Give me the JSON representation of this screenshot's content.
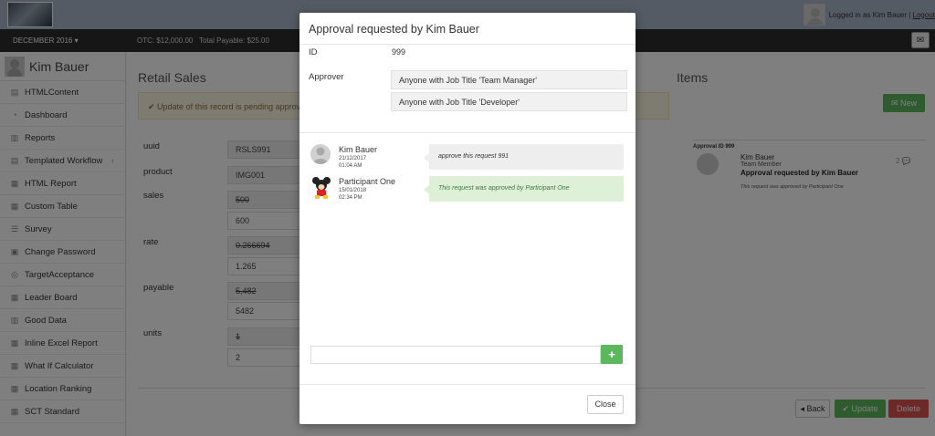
{
  "header": {
    "logged_in_text": "Logged in as Kim Bauer |",
    "logout_label": "Logout",
    "month_label": "DECEMBER 2016 ▾",
    "otc": "OTC: $12,000.00",
    "total_payable": "Total Payable: $25.00",
    "mail_icon": "envelope-icon"
  },
  "sidebar": {
    "user_name": "Kim Bauer",
    "items": [
      {
        "label": "HTMLContent",
        "icon": "file-icon"
      },
      {
        "label": "Dashboard",
        "icon": "dashboard-icon"
      },
      {
        "label": "Reports",
        "icon": "bar-chart-icon"
      },
      {
        "label": "Templated Workflow",
        "icon": "file-icon",
        "chevron": "‹"
      },
      {
        "label": "HTML Report",
        "icon": "table-icon"
      },
      {
        "label": "Custom Table",
        "icon": "table-icon"
      },
      {
        "label": "Survey",
        "icon": "list-icon"
      },
      {
        "label": "Change Password",
        "icon": "lock-icon"
      },
      {
        "label": "TargetAcceptance",
        "icon": "target-icon"
      },
      {
        "label": "Leader Board",
        "icon": "table-icon"
      },
      {
        "label": "Good Data",
        "icon": "bar-chart-icon"
      },
      {
        "label": "Inline Excel Report",
        "icon": "table-icon"
      },
      {
        "label": "What If Calculator",
        "icon": "table-icon"
      },
      {
        "label": "Location Ranking",
        "icon": "table-icon"
      },
      {
        "label": "SCT Standard",
        "icon": "table-icon"
      }
    ]
  },
  "retail": {
    "title": "Retail Sales",
    "pending_msg": "✔ Update of this record is pending approval.",
    "fields": {
      "uuid_label": "uuid",
      "uuid_value": "RSLS991",
      "product_label": "product",
      "product_value": "IMG001",
      "sales_label": "sales",
      "sales_old": "500",
      "sales_new": "600",
      "rate_label": "rate",
      "rate_old": "0.266694",
      "rate_new": "1.265",
      "payable_label": "payable",
      "payable_old": "5,482",
      "payable_new": "5482",
      "units_label": "units",
      "units_old": "1",
      "units_new": "2"
    },
    "buttons": {
      "back": "◂ Back",
      "update": "✔ Update",
      "delete": "Delete"
    }
  },
  "items": {
    "title": "Items",
    "new_label": "✉ New",
    "approval": {
      "id_label": "Approval ID 999",
      "name": "Kim Bauer",
      "role": "Team Member",
      "title": "Approval requested by Kim Bauer",
      "message": "This request was approved by Participant One",
      "count": "2 💬"
    }
  },
  "modal": {
    "title": "Approval requested by Kim Bauer",
    "id_label": "ID",
    "id_value": "999",
    "approver_label": "Approver",
    "approvers": [
      "Anyone with Job Title 'Team Manager'",
      "Anyone with Job Title 'Developer'"
    ],
    "comments": [
      {
        "name": "Kim Bauer",
        "date": "21/12/2017",
        "time": "01:04 AM",
        "message": "approve this request 991",
        "style": "grey"
      },
      {
        "name": "Participant One",
        "date": "15/01/2018",
        "time": "02:34 PM",
        "message": "This request was approved by Participant One",
        "style": "green"
      }
    ],
    "comment_placeholder": "",
    "add_label": "+",
    "close_label": "Close"
  },
  "colors": {
    "success": "#5cb85c",
    "danger": "#d9534f",
    "topbar": "#a9b6c9"
  }
}
